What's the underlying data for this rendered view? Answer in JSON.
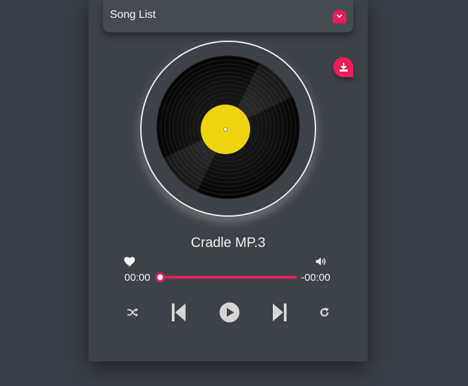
{
  "song_list": {
    "label": "Song List",
    "toggle_icon": "chevron-down-icon"
  },
  "download": {
    "icon": "download-icon"
  },
  "now_playing": {
    "title": "Cradle MP.3"
  },
  "progress": {
    "elapsed": "00:00",
    "remaining": "-00:00",
    "fraction": 0
  },
  "icons": {
    "favorite": "heart-icon",
    "volume": "volume-icon",
    "shuffle": "shuffle-icon",
    "previous": "skip-previous-icon",
    "play": "play-icon",
    "next": "skip-next-icon",
    "repeat": "repeat-icon"
  },
  "colors": {
    "accent": "#e91e5a",
    "background": "#3a3f47",
    "panel": "#3d4249",
    "label_yellow": "#eed40e"
  }
}
